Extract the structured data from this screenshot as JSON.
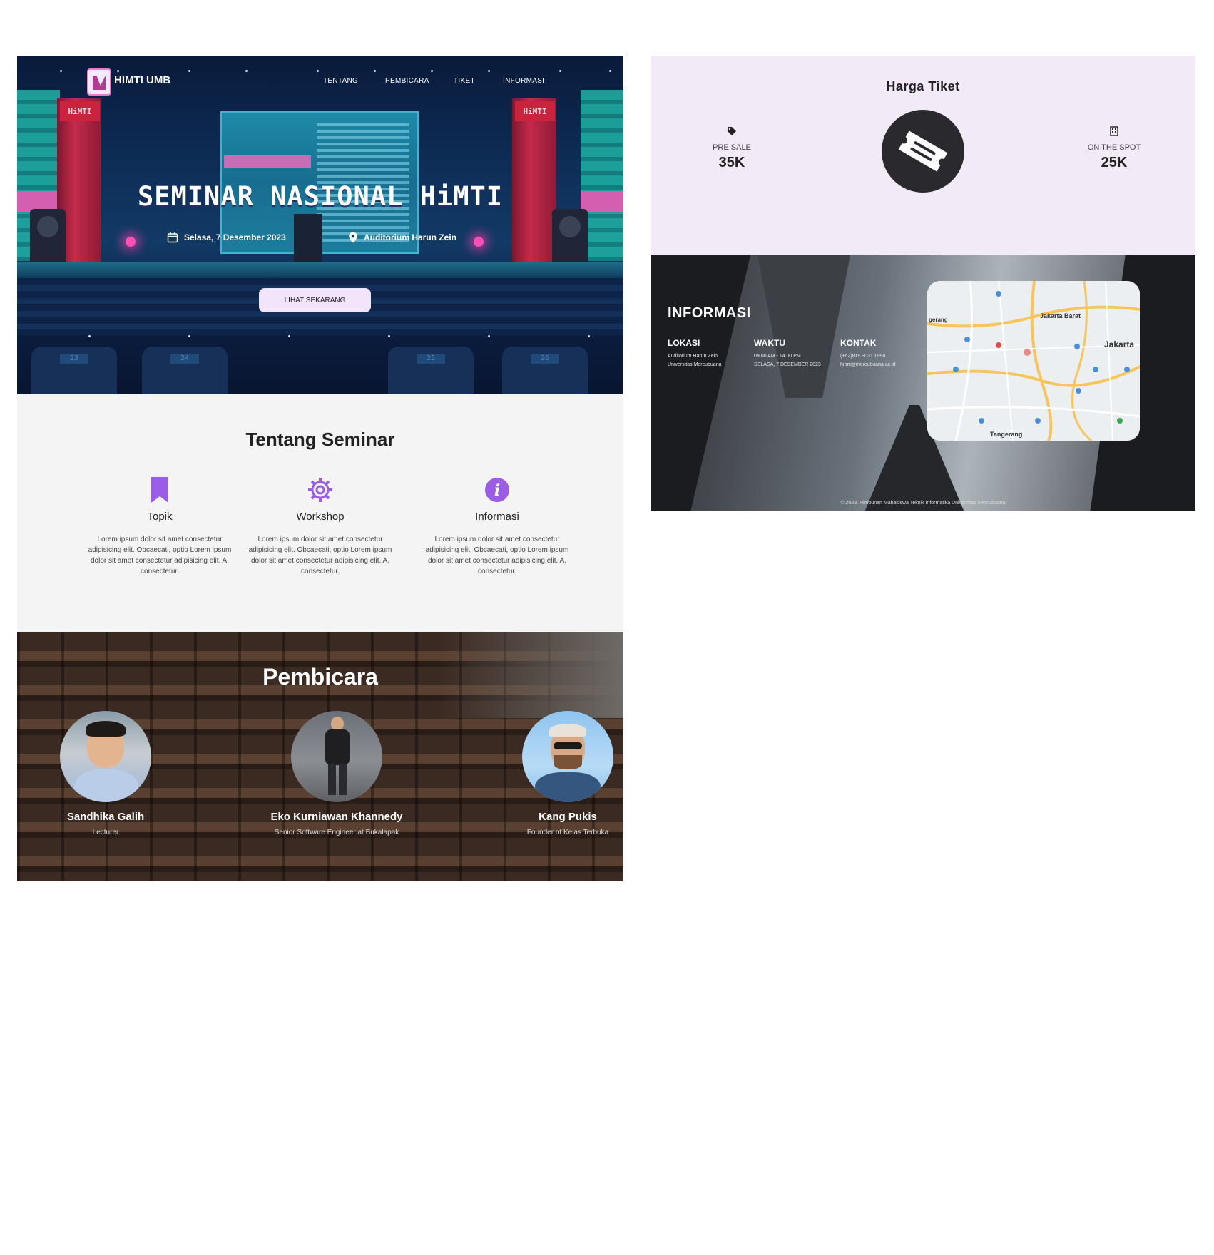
{
  "hero": {
    "logo_text": "HIMTI UMB",
    "banner_text": "HiMTI",
    "nav": [
      "TENTANG",
      "PEMBICARA",
      "TIKET",
      "INFORMASI"
    ],
    "title": "SEMINAR NASIONAL HiMTI",
    "date": "Selasa, 7 Desember 2023",
    "venue": "Auditorium Harun Zein",
    "cta_label": "LIHAT SEKARANG",
    "seat_numbers": [
      "23",
      "24",
      "25",
      "26"
    ]
  },
  "about": {
    "title": "Tentang Seminar",
    "features": [
      {
        "icon": "bookmark-icon",
        "title": "Topik",
        "text": "Lorem ipsum dolor sit amet consectetur adipisicing elit. Obcaecati, optio Lorem ipsum dolor sit amet consectetur adipisicing elit. A, consectetur."
      },
      {
        "icon": "gear-icon",
        "title": "Workshop",
        "text": "Lorem ipsum dolor sit amet consectetur adipisicing elit. Obcaecati, optio Lorem ipsum dolor sit amet consectetur adipisicing elit. A, consectetur."
      },
      {
        "icon": "info-icon",
        "title": "Informasi",
        "text": "Lorem ipsum dolor sit amet consectetur adipisicing elit. Obcaecati, optio Lorem ipsum dolor sit amet consectetur adipisicing elit. A, consectetur."
      }
    ],
    "accent_color": "#9b5de5"
  },
  "speakers": {
    "title": "Pembicara",
    "items": [
      {
        "name": "Sandhika Galih",
        "role": "Lecturer"
      },
      {
        "name": "Eko Kurniawan Khannedy",
        "role": "Senior Software Engineer at Bukalapak"
      },
      {
        "name": "Kang Pukis",
        "role": "Founder of Kelas Terbuka"
      }
    ]
  },
  "ticket": {
    "title": "Harga Tiket",
    "presale_label": "PRE SALE",
    "presale_price": "35K",
    "onspot_label": "ON THE SPOT",
    "onspot_price": "25K"
  },
  "info": {
    "title": "INFORMASI",
    "columns": [
      {
        "heading": "LOKASI",
        "line1": "Auditorium Harun Zein",
        "line2": "Universitas Mercubuana"
      },
      {
        "heading": "WAKTU",
        "line1": "09.00 AM - 14.00 PM",
        "line2": "SELASA, 7 DESEMBER 2023"
      },
      {
        "heading": "KONTAK",
        "line1": "(+62)819 9031 1998",
        "line2": "himti@mercubuana.ac.id"
      }
    ],
    "map_labels": {
      "jakarta": "Jakarta",
      "jakarta_barat": "Jakarta Barat",
      "tangerang": "Tangerang",
      "gerang": "gerang"
    },
    "footer": "© 2023. Himpunan Mahasiswa Teknik Informatika Universitas Mercubuana"
  }
}
